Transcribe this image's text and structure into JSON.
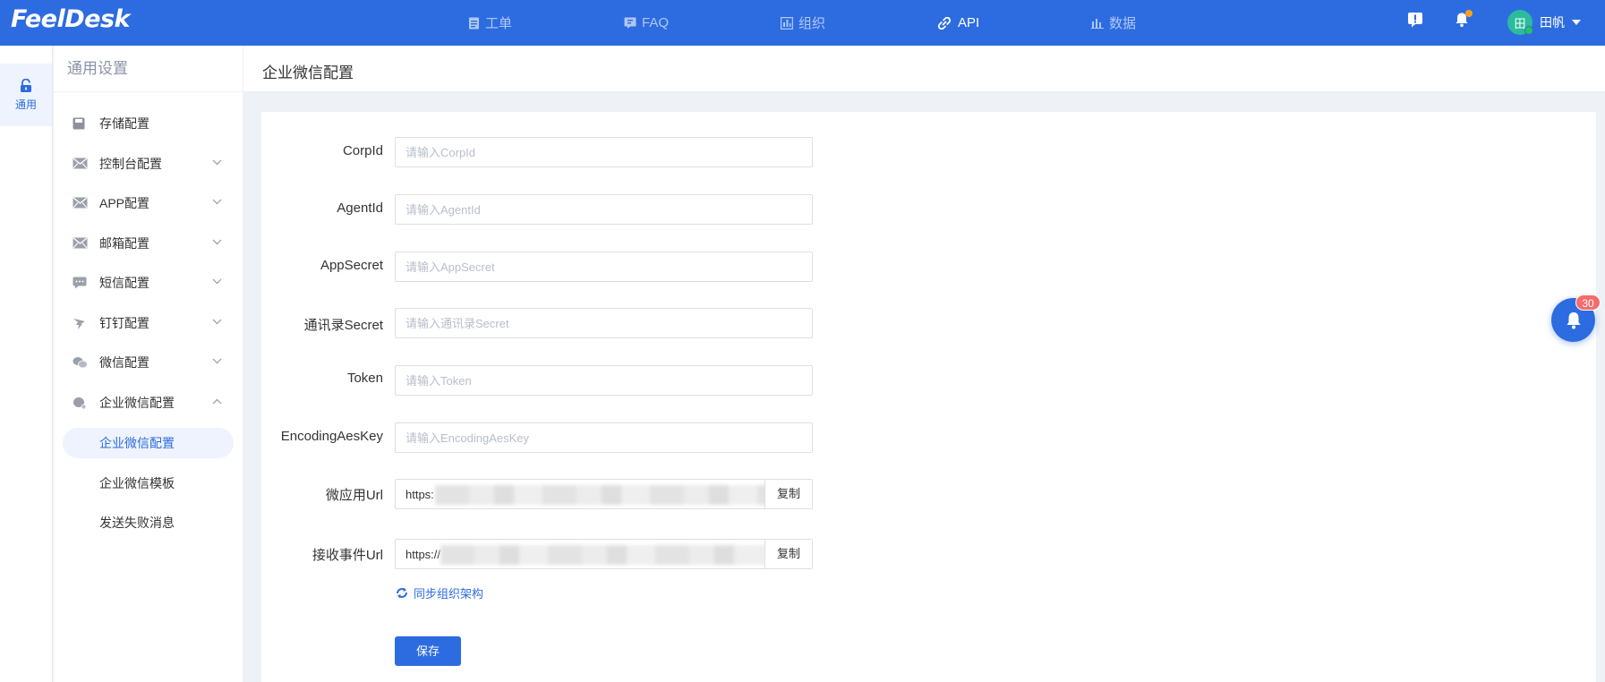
{
  "app": {
    "logo": "FeelDesk",
    "nav": [
      {
        "label": "工单",
        "icon": "document-icon"
      },
      {
        "label": "FAQ",
        "icon": "flag-icon"
      },
      {
        "label": "组织",
        "icon": "building-icon"
      },
      {
        "label": "API",
        "icon": "link-icon",
        "active": true
      },
      {
        "label": "数据",
        "icon": "bar-chart-icon"
      }
    ],
    "user": {
      "avatar_text": "田",
      "name": "田帆"
    },
    "accent_color": "#2d6ce0"
  },
  "rail": {
    "label": "通用",
    "icon": "unlock-icon"
  },
  "sidebar": {
    "title": "通用设置",
    "items": [
      {
        "label": "存储配置",
        "icon": "floppy-icon"
      },
      {
        "label": "控制台配置",
        "icon": "mail-icon"
      },
      {
        "label": "APP配置",
        "icon": "mail-icon"
      },
      {
        "label": "邮箱配置",
        "icon": "mail-icon"
      },
      {
        "label": "短信配置",
        "icon": "chat-icon"
      },
      {
        "label": "钉钉配置",
        "icon": "dingtalk-icon"
      },
      {
        "label": "微信配置",
        "icon": "wechat-icon"
      },
      {
        "label": "企业微信配置",
        "icon": "wecom-icon",
        "expanded": true
      }
    ],
    "sub_items": [
      {
        "label": "企业微信配置",
        "active": true
      },
      {
        "label": "企业微信模板"
      },
      {
        "label": "发送失败消息"
      }
    ]
  },
  "page": {
    "title": "企业微信配置"
  },
  "form": {
    "fields": [
      {
        "label": "CorpId",
        "placeholder": "请输入CorpId",
        "value": ""
      },
      {
        "label": "AgentId",
        "placeholder": "请输入AgentId",
        "value": ""
      },
      {
        "label": "AppSecret",
        "placeholder": "请输入AppSecret",
        "value": ""
      },
      {
        "label": "通讯录Secret",
        "placeholder": "请输入通讯录Secret",
        "value": ""
      },
      {
        "label": "Token",
        "placeholder": "请输入Token",
        "value": ""
      },
      {
        "label": "EncodingAesKey",
        "placeholder": "请输入EncodingAesKey",
        "value": ""
      }
    ],
    "url_fields": [
      {
        "label": "微应用Url",
        "value": "https:",
        "copy_label": "复制"
      },
      {
        "label": "接收事件Url",
        "value": "https://",
        "copy_label": "复制"
      }
    ],
    "sync_label": "同步组织架构",
    "save_label": "保存"
  },
  "notifications": {
    "count": "30"
  }
}
